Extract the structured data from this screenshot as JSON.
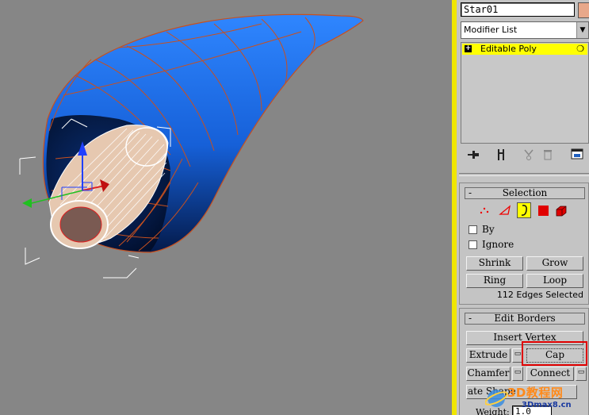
{
  "object_name": "Star01",
  "object_color": "#e8a88a",
  "modifier_list": {
    "label": "Modifier List",
    "arrow": "▼"
  },
  "stack": {
    "item_label": "Editable Poly",
    "expand_symbol": "+",
    "bulb_glyph": "❍"
  },
  "stack_tools": [
    "pin-stack-icon",
    "show-end-result-icon",
    "make-unique-icon",
    "remove-modifier-icon",
    "configure-sets-icon"
  ],
  "selection": {
    "collapse_symbol": "-",
    "title": "Selection",
    "by_label": "By",
    "ignore_label": "Ignore",
    "shrink": "Shrink",
    "grow": "Grow",
    "ring": "Ring",
    "loop": "Loop",
    "status": "112 Edges Selected"
  },
  "edit_borders": {
    "collapse_symbol": "-",
    "title": "Edit Borders",
    "insert_vertex": "Insert Vertex",
    "extrude": "Extrude",
    "cap": "Cap",
    "chamfer": "Chamfer",
    "connect": "Connect",
    "create_shape": "ate Shape",
    "weight_label": "Weight:",
    "weight_value": "1.0"
  },
  "watermark": {
    "text_large": "3D教程网",
    "text_small": "3Dmax8.cn"
  },
  "colors": {
    "viewport_bg": "#868686",
    "mesh_blue": "#1c6fe0",
    "mesh_edge": "#c8501e",
    "panel_bg": "#c4c4c4",
    "highlight": "#e00000",
    "active_stack": "#ffff00"
  }
}
